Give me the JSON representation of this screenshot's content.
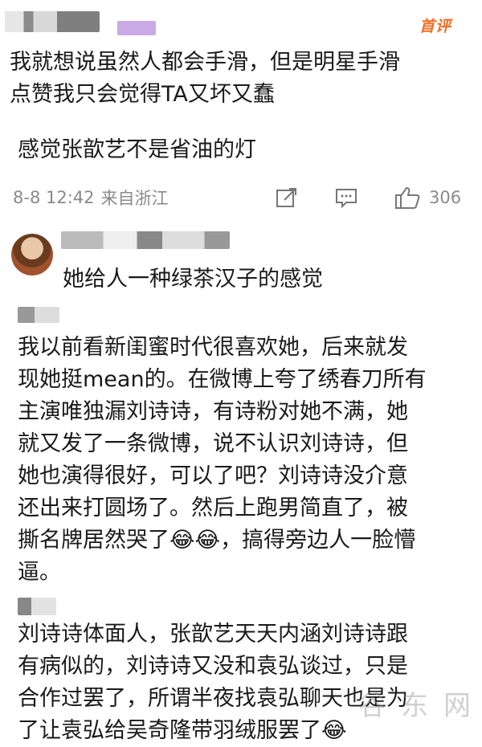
{
  "top_comment": {
    "badge": "首评",
    "lines": [
      "我就想说虽然人都会手滑，但是明星手滑",
      "点赞我只会觉得TA又坏又蠢"
    ],
    "extra": "感觉张歆艺不是省油的灯",
    "time": "8-8 12:42",
    "source": "来自浙江",
    "like_count": "306"
  },
  "reply": {
    "text": "她给人一种绿茶汉子的感觉"
  },
  "comment2": {
    "lines": [
      "我以前看新闺蜜时代很喜欢她，后来就发",
      "现她挺mean的。在微博上夸了绣春刀所有",
      "主演唯独漏刘诗诗，有诗粉对她不满，她",
      "就又发了一条微博，说不认识刘诗诗，但",
      "她也演得很好，可以了吧？刘诗诗没介意",
      "还出来打圆场了。然后上跑男简直了，被",
      "撕名牌居然哭了😂😂，搞得旁边人一脸懵",
      "逼。"
    ]
  },
  "comment3": {
    "lines": [
      "刘诗诗体面人，张歆艺天天内涵刘诗诗跟",
      "有病似的，刘诗诗又没和袁弘谈过，只是",
      "合作过罢了，所谓半夜找袁弘聊天也是为",
      "了让袁弘给吴奇隆带羽绒服罢了😂"
    ]
  },
  "watermark": "谷 东 网",
  "icons": [
    "share-icon",
    "comment-icon",
    "like-icon"
  ]
}
